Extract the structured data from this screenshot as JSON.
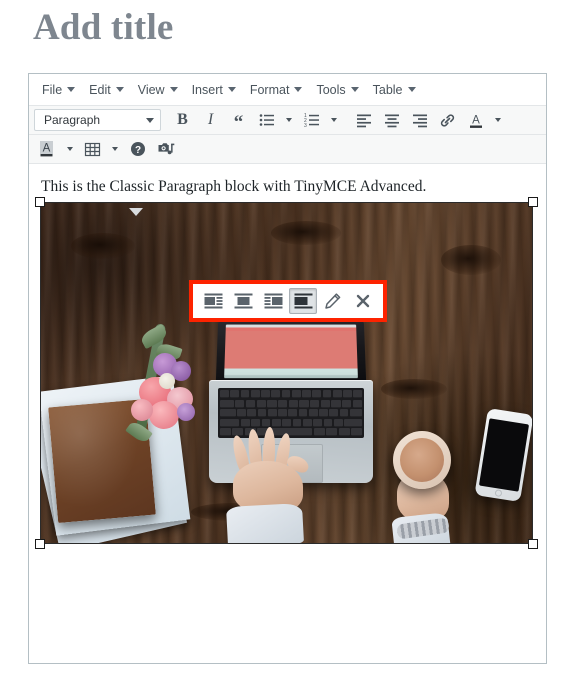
{
  "page": {
    "title_placeholder": "Add title"
  },
  "editor": {
    "menubar": [
      {
        "label": "File",
        "icon": "chevron-down-icon"
      },
      {
        "label": "Edit",
        "icon": "chevron-down-icon"
      },
      {
        "label": "View",
        "icon": "chevron-down-icon"
      },
      {
        "label": "Insert",
        "icon": "chevron-down-icon"
      },
      {
        "label": "Format",
        "icon": "chevron-down-icon"
      },
      {
        "label": "Tools",
        "icon": "chevron-down-icon"
      },
      {
        "label": "Table",
        "icon": "chevron-down-icon"
      }
    ],
    "format_select": {
      "value": "Paragraph",
      "caret_icon": "chevron-down-icon"
    },
    "toolbar_row1": [
      {
        "name": "bold-button",
        "glyph": "B",
        "icon": "bold-icon"
      },
      {
        "name": "italic-button",
        "glyph": "I",
        "icon": "italic-icon"
      },
      {
        "name": "blockquote-button",
        "glyph": "“",
        "icon": "blockquote-icon"
      },
      {
        "name": "bullet-list-button",
        "icon": "bullet-list-icon"
      },
      {
        "name": "bullet-list-options",
        "icon": "chevron-down-icon"
      },
      {
        "name": "numbered-list-button",
        "icon": "numbered-list-icon"
      },
      {
        "name": "numbered-list-options",
        "icon": "chevron-down-icon"
      },
      {
        "name": "align-left-button",
        "icon": "align-left-icon"
      },
      {
        "name": "align-center-button",
        "icon": "align-center-icon"
      },
      {
        "name": "align-right-button",
        "icon": "align-right-icon"
      },
      {
        "name": "insert-link-button",
        "icon": "link-icon"
      },
      {
        "name": "text-color-button",
        "icon": "text-color-icon"
      },
      {
        "name": "text-color-options",
        "icon": "chevron-down-icon"
      }
    ],
    "toolbar_row2": [
      {
        "name": "background-color-button",
        "icon": "background-color-icon"
      },
      {
        "name": "background-color-options",
        "icon": "chevron-down-icon"
      },
      {
        "name": "table-button",
        "icon": "table-icon"
      },
      {
        "name": "table-options",
        "icon": "chevron-down-icon"
      },
      {
        "name": "help-button",
        "icon": "help-circle-icon"
      },
      {
        "name": "insert-media-button",
        "icon": "media-camera-icon"
      }
    ],
    "body_text": "This is the Classic Paragraph block with TinyMCE Advanced.",
    "image": {
      "alt": "Overhead photo of a wooden desk with an open laptop, hands typing, a cup of coffee, a smartphone, a leather notebook and pink flowers",
      "selected": true,
      "handles": [
        "top-left",
        "top-right",
        "bottom-left",
        "bottom-right"
      ]
    }
  },
  "image_toolbar": {
    "highlighted": true,
    "highlight_color": "#fd2300",
    "buttons": [
      {
        "name": "align-left-image-button",
        "icon": "image-align-left-icon",
        "active": false,
        "title": "Align left"
      },
      {
        "name": "align-center-image-button",
        "icon": "image-align-center-icon",
        "active": false,
        "title": "Align center"
      },
      {
        "name": "align-right-image-button",
        "icon": "image-align-right-icon",
        "active": false,
        "title": "Align right"
      },
      {
        "name": "no-alignment-image-button",
        "icon": "image-no-alignment-icon",
        "active": true,
        "title": "No alignment"
      },
      {
        "name": "edit-image-button",
        "icon": "pencil-icon",
        "active": false,
        "title": "Edit image"
      },
      {
        "name": "remove-image-button",
        "icon": "close-x-icon",
        "active": false,
        "title": "Remove image"
      }
    ]
  },
  "colors": {
    "title_text": "#7e868f",
    "toolbar_bg": "#f7f8f8",
    "icon": "#4a545c",
    "editor_border": "#b4bfc4",
    "highlight": "#fd2300",
    "laptop_screen": "#dd7b74"
  }
}
